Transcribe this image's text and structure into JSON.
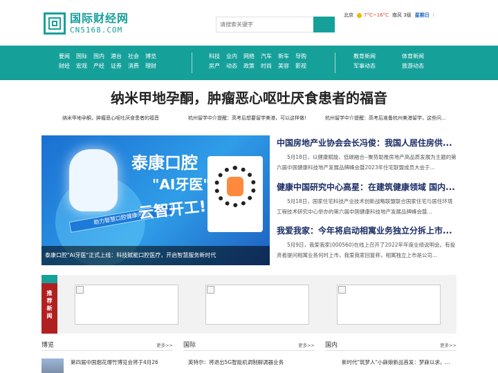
{
  "header": {
    "logo_cn": "国际财经网",
    "logo_en": "CN5168.COM",
    "search_placeholder": "请搜索关键字",
    "weather": {
      "city": "北京",
      "temp": "7°C~16°C",
      "wind": "南风 3级",
      "weekday": "星期日",
      "more": "⁝"
    }
  },
  "nav": {
    "group1": [
      "要闻",
      "国际",
      "国内",
      "港台",
      "社会",
      "博览",
      "财经",
      "宏观",
      "产经",
      "证券",
      "消费",
      "理财"
    ],
    "group2": [
      "科技",
      "业内",
      "网络",
      "汽车",
      "新车",
      "导购",
      "房产",
      "动态",
      "政策",
      "时尚",
      "美容",
      "影视"
    ],
    "group3": [
      "教育新闻",
      "体育新闻",
      "军事动态",
      "旅游动态"
    ]
  },
  "headline": {
    "title": "纳米甲地孕酮，肿瘤恶心呕吐厌食患者的福音",
    "sub": [
      "纳米甲地孕酮，肿瘤恶心呕吐厌食患者的福音",
      "杭州留学中介提醒：高考后想要留学美港，可以这样做!",
      "杭州留学中介提醒：高考后准备杭州美港留学，这些问..."
    ]
  },
  "feature": {
    "title1": "泰康口腔",
    "title2": "\"AI牙医\"",
    "title3": "云智开工!",
    "band": "助力智慧口腔健康问题",
    "caption": "泰康口腔\"AI牙医\"正式上线：科技赋能口腔医疗，开启智慧服务新时代"
  },
  "news": [
    {
      "title": "中国房地产业协会会长冯俊：我国人居住房供...",
      "desc": "5月18日，以健康赋能、低碳融合--聚势助推房地产高品质发展为主题的第六届中国健康科技地产发展品牌峰会暨2023年住宅联盟成员大会于..."
    },
    {
      "title": "健康中国研究中心高星：在建筑健康领域 国内...",
      "desc": "5月18日，国家住宅科技产业技术创新战略联盟联合国家住宅与居住环境工程技术研究中心举办的第六届中国健康科技地产发展品牌峰会暨..."
    },
    {
      "title": "我爱我家：今年将启动相寓业务独立分拆上市...",
      "desc": "5月9日，我爱我家(000560)在线上召开了2022年年度业绩说明会。有投资者提问相寓业务何时上市，我爱我家回复称，相寓独立上市是公司..."
    }
  ],
  "recommend": {
    "label": [
      "推",
      "荐",
      "新",
      "闻"
    ]
  },
  "columns": [
    {
      "title": "博览",
      "more": "更多>>",
      "item": "第四届中国烟花爆竹博览会将于4月26"
    },
    {
      "title": "国际",
      "more": "更多>>",
      "item": "英特尔：将退出5G智能机调制解调器业务"
    },
    {
      "title": "国内",
      "more": "更多>>",
      "item": "新时代\"筑梦人\"小寐娘新品首发：梦寐以求，..."
    }
  ]
}
